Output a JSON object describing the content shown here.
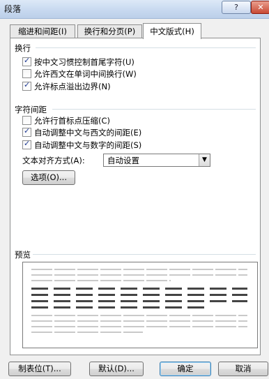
{
  "window": {
    "title": "段落",
    "help": "?",
    "close": "✕"
  },
  "tabs": [
    {
      "label": "缩进和间距(I)",
      "active": false
    },
    {
      "label": "换行和分页(P)",
      "active": false
    },
    {
      "label": "中文版式(H)",
      "active": true
    }
  ],
  "line_breaking": {
    "title": "换行",
    "options": [
      {
        "label": "按中文习惯控制首尾字符(U)",
        "checked": true
      },
      {
        "label": "允许西文在单词中间换行(W)",
        "checked": false
      },
      {
        "label": "允许标点溢出边界(N)",
        "checked": true
      }
    ]
  },
  "char_spacing": {
    "title": "字符间距",
    "options": [
      {
        "label": "允许行首标点压缩(C)",
        "checked": false
      },
      {
        "label": "自动调整中文与西文的间距(E)",
        "checked": true
      },
      {
        "label": "自动调整中文与数字的间距(S)",
        "checked": true
      }
    ],
    "align_label": "文本对齐方式(A):",
    "align_value": "自动设置",
    "options_button": "选项(O)..."
  },
  "preview": {
    "title": "预览"
  },
  "footer": {
    "tabs_button": "制表位(T)...",
    "default_button": "默认(D)...",
    "ok_button": "确定",
    "cancel_button": "取消"
  }
}
